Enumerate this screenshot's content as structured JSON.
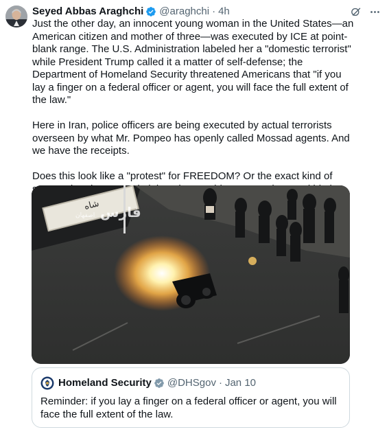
{
  "tweet": {
    "author_name": "Seyed Abbas Araghchi",
    "handle": "@araghchi",
    "separator": "·",
    "time": "4h",
    "paragraphs": [
      "Just the other day, an innocent young woman in the United States—an American citizen and mother of three—was executed by ICE at point-blank range. The U.S. Administration labeled her a \"domestic terrorist\" while President Trump called it a matter of self-defense; the Department of Homeland Security threatened Americans that \"if you lay a finger on a federal officer or agent, you will face the full extent of the law.\"",
      "Here in Iran, police officers are being executed by actual terrorists overseen by what Mr. Pompeo has openly called Mossad agents. And we have the receipts.",
      "Does this look like a \"protest\" for FREEDOM? Or the exact kind of scenes that the U.S. Administration would NEVER tolerate within its own borders?"
    ],
    "media": {
      "watermark": "فارس",
      "watermark_sub": "اصفهان",
      "sign_text": "شاه"
    }
  },
  "quote": {
    "author_name": "Homeland Security",
    "handle": "@DHSgov",
    "separator": "·",
    "date": "Jan 10",
    "text": "Reminder: if you lay a finger on a federal officer or agent, you will face the full extent of the law."
  },
  "colors": {
    "verified_blue": "#1d9bf0",
    "muted_text": "#536471",
    "border": "#cfd9de"
  },
  "icons": {
    "verified": "verified-badge-icon",
    "grok": "grok-icon",
    "more": "more-icon"
  }
}
